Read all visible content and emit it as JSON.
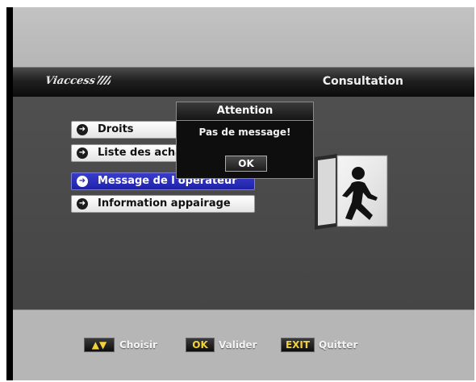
{
  "header": {
    "logo_text": "Viaccess",
    "title": "Consultation"
  },
  "menu": {
    "items": [
      {
        "label": "Droits",
        "selected": false
      },
      {
        "label": "Liste des achats",
        "selected": false
      },
      {
        "label": "Message de l'opérateur",
        "selected": true
      },
      {
        "label": "Information appairage",
        "selected": false
      }
    ],
    "bullet_icon": "arrow-right-circle-icon"
  },
  "illustration": {
    "icon": "exit-door-person-icon"
  },
  "dialog": {
    "title": "Attention",
    "message": "Pas de message!",
    "ok_label": "OK"
  },
  "footer": {
    "choose": {
      "key": "▲▼",
      "label": "Choisir"
    },
    "validate": {
      "key": "OK",
      "label": "Valider"
    },
    "quit": {
      "key": "EXIT",
      "label": "Quitter"
    }
  },
  "colors": {
    "selected": "#2a2cb8",
    "key_text": "#f2d23a",
    "header": "#111111"
  }
}
